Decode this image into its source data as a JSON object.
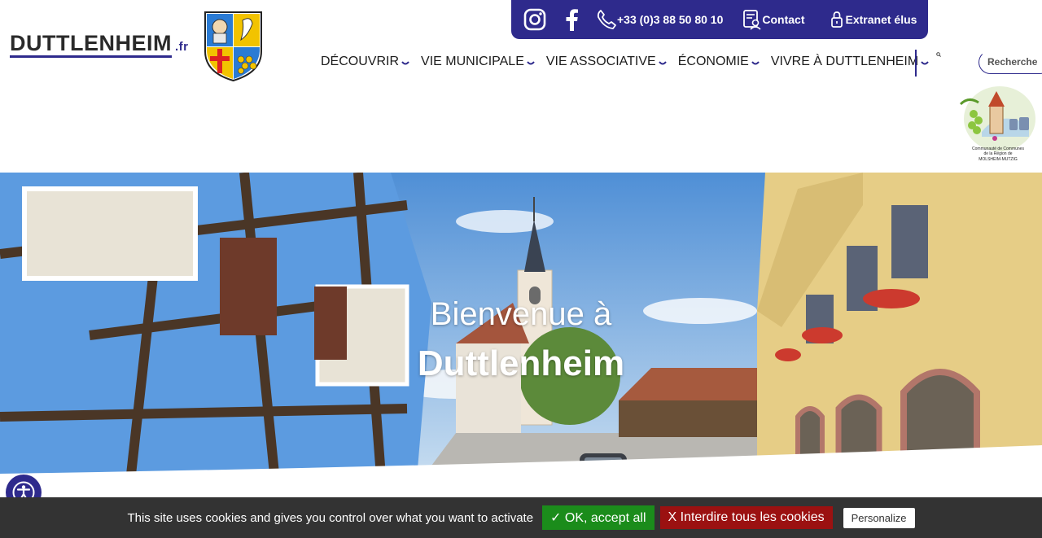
{
  "header": {
    "logo_main": "DUTTLENHEIM",
    "logo_ext": ".fr",
    "crest_icon": "coat-of-arms-icon",
    "comcom_logo_icon": "communaute-de-communes-logo-icon"
  },
  "topbar": {
    "bg_color": "#2e2a8c",
    "instagram_icon": "instagram-icon",
    "facebook_icon": "facebook-icon",
    "phone_label": "+33 (0)3 88 50 80 10",
    "contact_label": "Contact",
    "extranet_label": "Extranet élus"
  },
  "nav": {
    "items": [
      {
        "label": "DÉCOUVRIR"
      },
      {
        "label": "VIE MUNICIPALE"
      },
      {
        "label": "VIE ASSOCIATIVE"
      },
      {
        "label": "ÉCONOMIE"
      },
      {
        "label": "VIVRE À DUTTLENHEIM"
      }
    ],
    "search_placeholder": "Recherche"
  },
  "hero": {
    "line1": "Bienvenue à",
    "line2": "Duttlenheim"
  },
  "cookie": {
    "message": "This site uses cookies and gives you control over what you want to activate",
    "accept_label": "✓ OK, accept all",
    "deny_label": "X Interdire tous les cookies",
    "personalize_label": "Personalize",
    "accept_color": "#1b8c1b",
    "deny_color": "#9b1111"
  },
  "accessibility_icon": "accessibility-icon"
}
